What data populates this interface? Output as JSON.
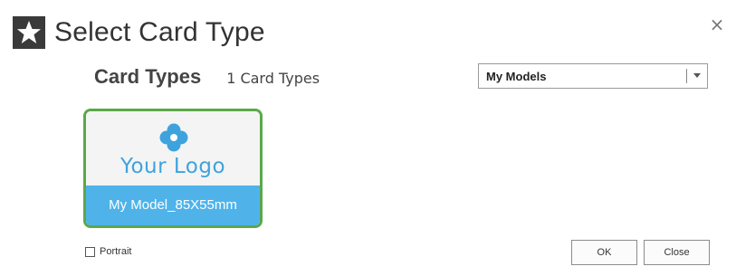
{
  "window": {
    "title": "Select Card Type",
    "title_icon": "star-icon",
    "close_icon": "close-icon",
    "close_glyph": "×"
  },
  "header": {
    "heading": "Card Types",
    "count_text": "1 Card Types"
  },
  "filter": {
    "selected": "My Models",
    "arrow_icon": "chevron-down-icon"
  },
  "cards": [
    {
      "logo_icon": "clover-icon",
      "logo_text": "Your Logo",
      "label": "My Model_85X55mm",
      "selected": true
    }
  ],
  "options": {
    "portrait_label": "Portrait",
    "portrait_checked": false
  },
  "buttons": {
    "ok_label": "OK",
    "close_label": "Close"
  },
  "colors": {
    "title_icon_bg": "#3a3a3a",
    "card_border_selected": "#5aa84a",
    "card_label_bg": "#4fb3ea",
    "logo_color": "#3ea3dd"
  }
}
